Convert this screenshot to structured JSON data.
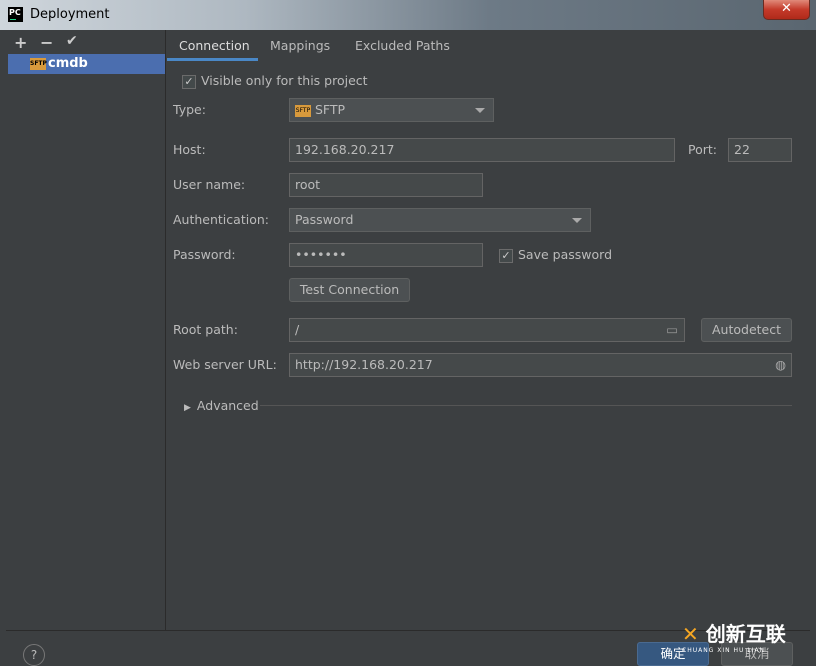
{
  "window": {
    "title": "Deployment",
    "app_icon": "PC",
    "close_icon": "close-icon"
  },
  "sidebar": {
    "toolbar": [
      "+",
      "−",
      "✔"
    ],
    "servers": [
      {
        "name": "cmdb",
        "icon": "SFTP"
      }
    ]
  },
  "tabs": [
    {
      "label": "Connection",
      "active": true
    },
    {
      "label": "Mappings"
    },
    {
      "label": "Excluded Paths"
    }
  ],
  "form": {
    "visible_only": {
      "label": "Visible only for this project",
      "checked": true
    },
    "type": {
      "label": "Type:",
      "value": "SFTP"
    },
    "host": {
      "label": "Host:",
      "value": "192.168.20.217"
    },
    "port": {
      "label": "Port:",
      "value": "22"
    },
    "username": {
      "label": "User name:",
      "value": "root"
    },
    "auth": {
      "label": "Authentication:",
      "value": "Password"
    },
    "password": {
      "label": "Password:",
      "value": "•••••••"
    },
    "save_password": {
      "label": "Save password",
      "checked": true
    },
    "test_connection": "Test Connection",
    "root_path": {
      "label": "Root path:",
      "value": "/"
    },
    "autodetect": "Autodetect",
    "web_url": {
      "label": "Web server URL:",
      "value": "http://192.168.20.217"
    },
    "advanced": "Advanced"
  },
  "footer": {
    "help": "?",
    "ok": "确定",
    "cancel": "取消"
  },
  "watermark": {
    "text": "创新互联",
    "sub": "CHUANG XIN HU LIAN"
  }
}
